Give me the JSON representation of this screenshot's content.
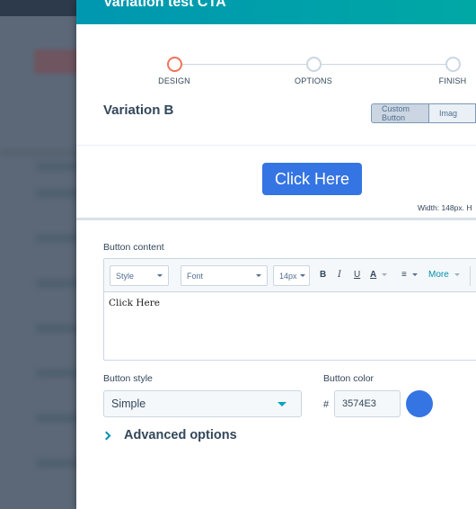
{
  "modal": {
    "title": "Variation test CTA"
  },
  "stepper": {
    "steps": [
      {
        "label": "DESIGN",
        "state": "active"
      },
      {
        "label": "OPTIONS",
        "state": "inactive"
      },
      {
        "label": "FINISH",
        "state": "inactive"
      }
    ]
  },
  "variation": {
    "title": "Variation B"
  },
  "type_toggle": {
    "options": [
      {
        "label": "Custom Button",
        "selected": true
      },
      {
        "label": "Imag",
        "selected": false
      }
    ]
  },
  "preview": {
    "button_label": "Click Here",
    "size_text": "Width: 148px. H"
  },
  "button_content": {
    "label": "Button content",
    "toolbar": {
      "style_select": "Style",
      "font_select": "Font",
      "size_select": "14px",
      "bold_icon": "B",
      "italic_icon": "I",
      "underline_icon": "U",
      "text_color_icon": "A",
      "align_icon": "≡",
      "more_label": "More"
    },
    "body_text": "Click Here"
  },
  "button_style": {
    "label": "Button style",
    "selected": "Simple"
  },
  "button_color": {
    "label": "Button color",
    "hash": "#",
    "value": "3574E3",
    "swatch_color": "#3574E3"
  },
  "advanced": {
    "label": "Advanced options"
  },
  "colors": {
    "accent_teal": "#00a4bd",
    "active_step": "#f2735a",
    "cta_blue": "#3574e3"
  }
}
